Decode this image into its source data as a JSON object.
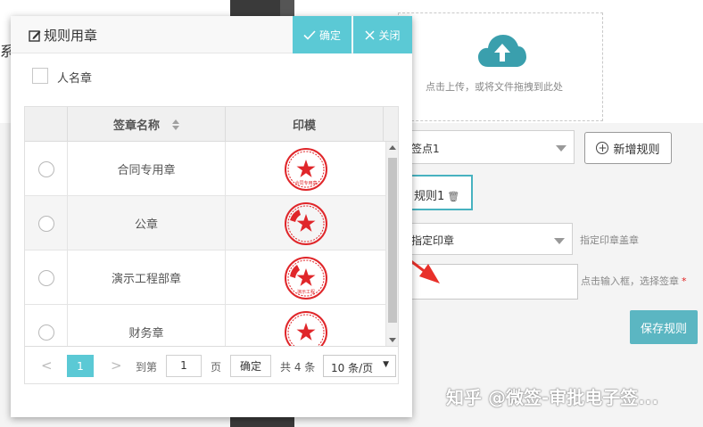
{
  "background": {
    "left_partial_char": "系",
    "upload": {
      "text": "点击上传，或将文件拖拽到此处",
      "icon": "cloud-upload-icon"
    },
    "signing_point_select": {
      "value": "签点1"
    },
    "add_rule_button": {
      "label": "新增规则"
    },
    "rule_tab": {
      "label": "规则1"
    },
    "seal_mode_select": {
      "value": "指定印章"
    },
    "seal_mode_hint": "指定印章盖章",
    "seal_input_hint": "点击输入框，选择签章",
    "required_mark": "*",
    "save_button": {
      "label": "保存规则"
    }
  },
  "watermark": "知乎 @微签-审批电子签...",
  "modal": {
    "title": "规则用章",
    "confirm_label": "确定",
    "close_label": "关闭",
    "personal_seal_label": "人名章",
    "columns": {
      "name": "签章名称",
      "seal": "印模"
    },
    "rows": [
      {
        "name": "合同专用章",
        "seal_text": "合同专用章"
      },
      {
        "name": "公章",
        "seal_text": ""
      },
      {
        "name": "演示工程部章",
        "seal_text": "演示工程"
      },
      {
        "name": "财务章",
        "seal_text": ""
      }
    ],
    "pager": {
      "current_page": "1",
      "goto_label": "到第",
      "page_input": "1",
      "page_unit": "页",
      "ok_label": "确定",
      "total": "共 4 条",
      "page_size": "10 条/页"
    }
  },
  "colors": {
    "accent": "#5bc9d5",
    "seal_red": "#e0262a",
    "arrow": "#e8302a"
  }
}
